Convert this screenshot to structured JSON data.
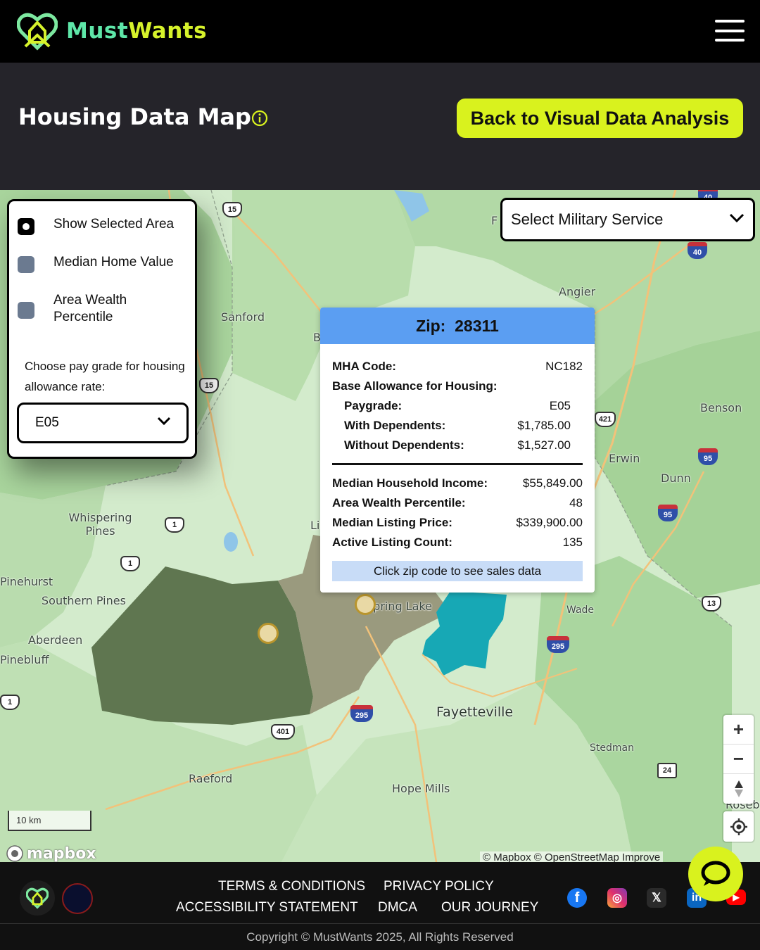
{
  "brand": {
    "name_part1": "Must",
    "name_part2": "Wants"
  },
  "header": {
    "title": "Housing Data Map",
    "back_button": "Back to Visual Data Analysis"
  },
  "layers": {
    "items": [
      {
        "label": "Show Selected Area",
        "selected": true
      },
      {
        "label": "Median Home Value",
        "selected": false
      },
      {
        "label": "Area Wealth Percentile",
        "selected": false
      }
    ],
    "pay_grade_label": "Choose pay grade for housing allowance rate:",
    "pay_grade_value": "E05"
  },
  "service_select": {
    "value": "Select Military Service"
  },
  "popup": {
    "zip_label": "Zip:",
    "zip": "28311",
    "mha_label": "MHA Code:",
    "mha_value": "NC182",
    "bah_label": "Base Allowance for Housing:",
    "paygrade_label": "Paygrade:",
    "paygrade_value": "E05",
    "with_dep_label": "With Dependents:",
    "with_dep_value": "$1,785.00",
    "without_dep_label": "Without Dependents:",
    "without_dep_value": "$1,527.00",
    "income_label": "Median Household Income:",
    "income_value": "$55,849.00",
    "wealth_label": "Area Wealth Percentile:",
    "wealth_value": "48",
    "listing_price_label": "Median Listing Price:",
    "listing_price_value": "$339,900.00",
    "listing_count_label": "Active Listing Count:",
    "listing_count_value": "135",
    "sales_button": "Click zip code to see sales data"
  },
  "map": {
    "places": [
      "Angier",
      "Sanford",
      "Benson",
      "Erwin",
      "Dunn",
      "Whispering Pines",
      "Pinehurst",
      "Southern Pines",
      "Aberdeen",
      "Pinebluff",
      "Spring Lake",
      "Wade",
      "Fayetteville",
      "Stedman",
      "Raeford",
      "Hope Mills",
      "Roseb",
      "Li",
      "B",
      "F"
    ],
    "shields": [
      "15",
      "40",
      "40",
      "421",
      "95",
      "95",
      "1",
      "1",
      "13",
      "295",
      "295",
      "401",
      "24",
      "1",
      "15"
    ],
    "scale": "10 km",
    "attribution": "© Mapbox © OpenStreetMap Improve",
    "mapbox": "mapbox",
    "colors": {
      "selected_zip": "#17a8b5",
      "area_dark": "#5f7650",
      "area_mid": "#9a9a7e"
    }
  },
  "footer": {
    "links": [
      "TERMS & CONDITIONS",
      "PRIVACY POLICY",
      "ACCESSIBILITY STATEMENT",
      "DMCA",
      "OUR JOURNEY"
    ],
    "copyright": "Copyright © MustWants 2025, All Rights Reserved",
    "social": [
      "facebook-icon",
      "instagram-icon",
      "x-icon",
      "linkedin-icon",
      "youtube-icon"
    ]
  }
}
